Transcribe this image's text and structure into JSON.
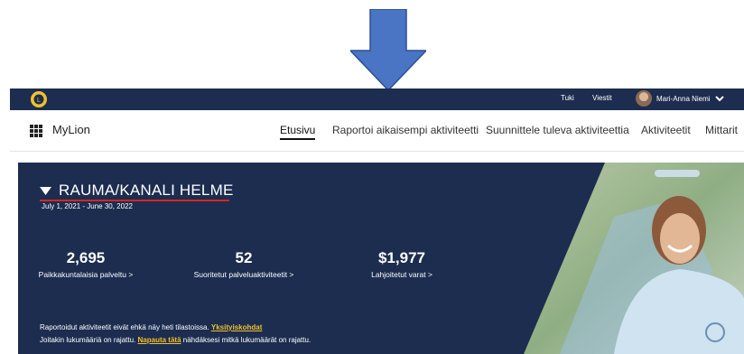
{
  "topbar": {
    "links": [
      "Tuki",
      "Viestit"
    ],
    "user_name": "Mari-Anna Niemi"
  },
  "navbar": {
    "brand": "MyLion",
    "items": [
      {
        "label": "Etusivu",
        "active": true
      },
      {
        "label": "Raportoi aikaisempi aktiviteetti",
        "active": false
      },
      {
        "label": "Suunnittele tuleva aktiviteettia",
        "active": false
      },
      {
        "label": "Aktiviteetit",
        "active": false
      },
      {
        "label": "Mittarit",
        "active": false
      }
    ]
  },
  "hero": {
    "club_name": "RAUMA/KANALI HELME",
    "date_range": "July 1, 2021 - June 30, 2022",
    "stats": [
      {
        "value": "2,695",
        "label": "Paikkakuntalaisia palveltu >"
      },
      {
        "value": "52",
        "label": "Suoritetut palveluaktiviteetit >"
      },
      {
        "value": "$1,977",
        "label": "Lahjoitetut varat >"
      }
    ],
    "notice1_text": "Raportoidut aktiviteetit eivät ehkä näy heti tilastoissa.",
    "notice1_link": "Yksityiskohdat",
    "notice2_text_before": "Joitakin lukumääriä on rajattu.",
    "notice2_link": "Napauta tätä",
    "notice2_text_after": "nähdäksesi mitkä lukumäärät on rajattu."
  },
  "colors": {
    "navy": "#1c2d4f",
    "accent_red": "#d9241f",
    "link_yellow": "#f2c12e",
    "arrow_blue": "#4a74c4"
  },
  "icons": [
    "down-arrow-icon",
    "lions-logo-icon",
    "chevron-down-icon",
    "grid-menu-icon",
    "caret-down-icon"
  ]
}
